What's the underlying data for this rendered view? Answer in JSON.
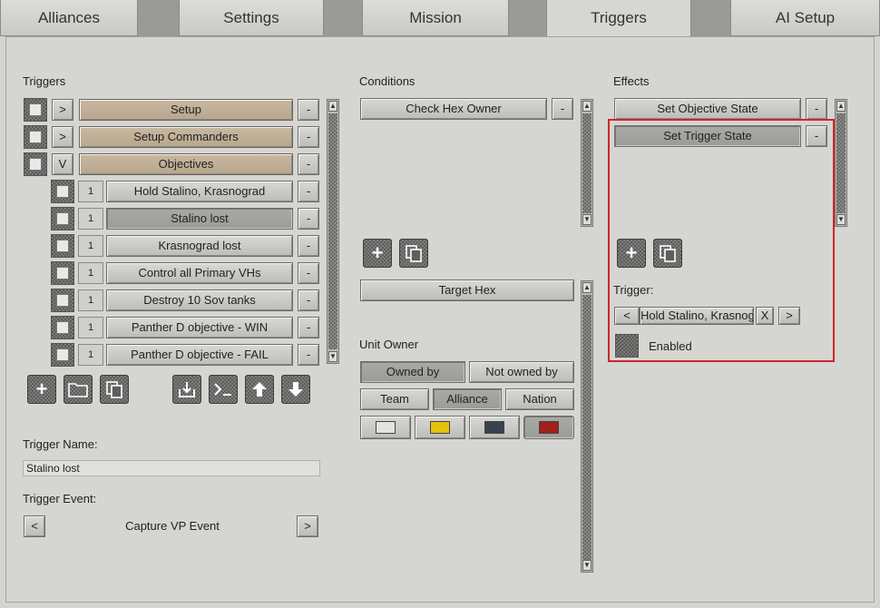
{
  "tabs": [
    {
      "label": "Alliances"
    },
    {
      "label": "Settings"
    },
    {
      "label": "Mission"
    },
    {
      "label": "Triggers"
    },
    {
      "label": "AI Setup"
    }
  ],
  "triggers_panel": {
    "title": "Triggers",
    "items": [
      {
        "expander": ">",
        "label": "Setup",
        "remove": "-"
      },
      {
        "expander": ">",
        "label": "Setup Commanders",
        "remove": "-"
      },
      {
        "expander": "V",
        "label": "Objectives",
        "remove": "-"
      }
    ],
    "children": [
      {
        "count": "1",
        "label": "Hold Stalino, Krasnograd",
        "remove": "-"
      },
      {
        "count": "1",
        "label": "Stalino lost",
        "remove": "-"
      },
      {
        "count": "1",
        "label": "Krasnograd lost",
        "remove": "-"
      },
      {
        "count": "1",
        "label": "Control all Primary VHs",
        "remove": "-"
      },
      {
        "count": "1",
        "label": "Destroy 10 Sov tanks",
        "remove": "-"
      },
      {
        "count": "1",
        "label": "Panther D  objective - WIN",
        "remove": "-"
      },
      {
        "count": "1",
        "label": "Panther D  objective - FAIL",
        "remove": "-"
      }
    ],
    "trigger_name_label": "Trigger Name:",
    "trigger_name_value": "Stalino lost",
    "trigger_event_label": "Trigger Event:",
    "trigger_event_value": "Capture VP Event",
    "prev": "<",
    "next": ">"
  },
  "conditions_panel": {
    "title": "Conditions",
    "items": [
      {
        "label": "Check Hex Owner",
        "remove": "-"
      }
    ],
    "target_hex": "Target Hex",
    "unit_owner_label": "Unit Owner",
    "owned_by": "Owned by",
    "not_owned_by": "Not owned by",
    "team": "Team",
    "alliance": "Alliance",
    "nation": "Nation",
    "swatch_colors": [
      "#e3e3e1",
      "#e4c10a",
      "#3a4150",
      "#a31f1b"
    ]
  },
  "effects_panel": {
    "title": "Effects",
    "items": [
      {
        "label": "Set Objective State",
        "remove": "-"
      },
      {
        "label": "Set Trigger State",
        "remove": "-"
      }
    ],
    "trigger_label": "Trigger:",
    "trigger_prev": "<",
    "trigger_value": "Hold Stalino, Krasnogra",
    "trigger_clear": "X",
    "trigger_next": ">",
    "enabled_label": "Enabled"
  },
  "colors": {
    "highlight": "#d42525",
    "tan": "#bcab90"
  }
}
